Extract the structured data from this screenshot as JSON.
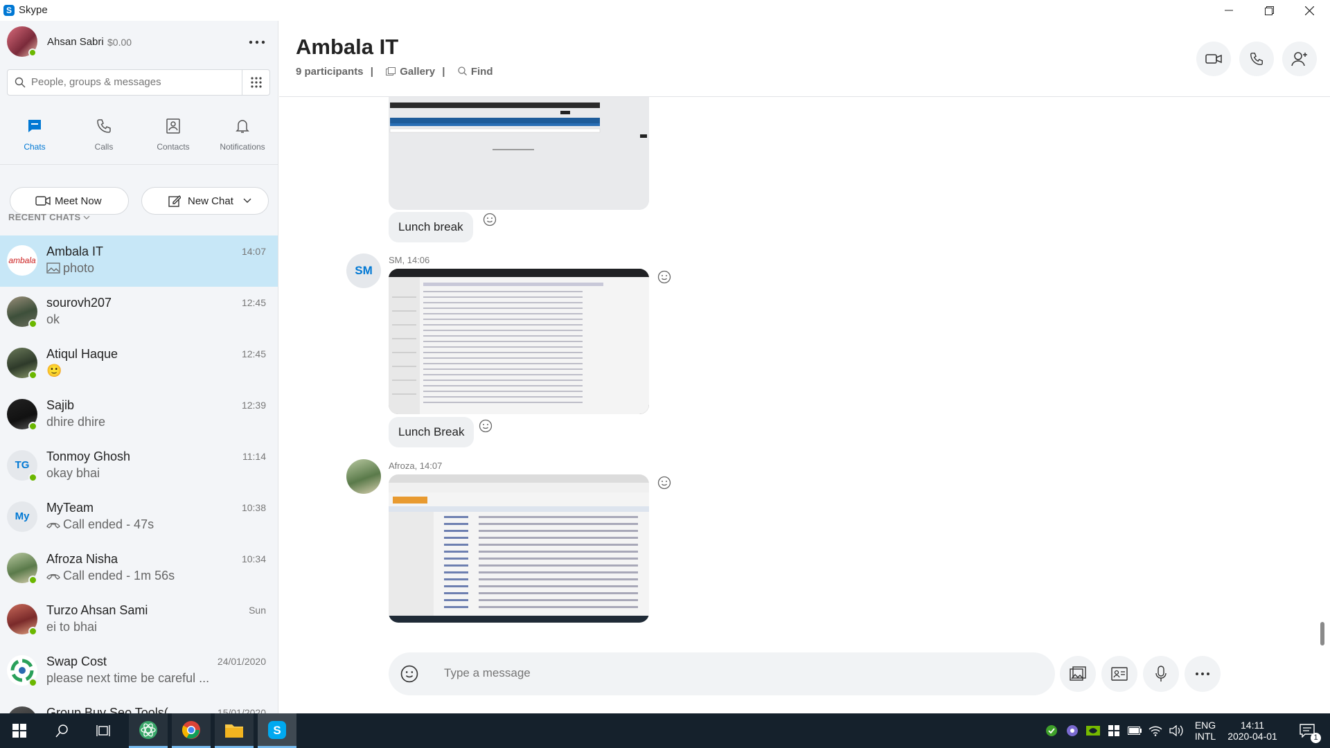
{
  "window": {
    "app_title": "Skype"
  },
  "profile": {
    "name": "Ahsan Sabri",
    "credit": "$0.00"
  },
  "search": {
    "placeholder": "People, groups & messages"
  },
  "nav": [
    {
      "label": "Chats",
      "icon": "chat-icon",
      "active": true
    },
    {
      "label": "Calls",
      "icon": "phone-icon"
    },
    {
      "label": "Contacts",
      "icon": "contacts-icon"
    },
    {
      "label": "Notifications",
      "icon": "bell-icon"
    }
  ],
  "actions": {
    "meet_now": "Meet Now",
    "new_chat": "New Chat"
  },
  "recent_header": "RECENT CHATS",
  "chats": [
    {
      "name": "Ambala IT",
      "preview": "photo",
      "time": "14:07",
      "avatar_text": "ambala",
      "selected": true
    },
    {
      "name": "sourovh207",
      "preview": "ok",
      "time": "12:45"
    },
    {
      "name": "Atiqul Haque",
      "preview": "🙂",
      "time": "12:45"
    },
    {
      "name": "Sajib",
      "preview": "dhire dhire",
      "time": "12:39"
    },
    {
      "name": "Tonmoy Ghosh",
      "preview": "okay bhai",
      "time": "11:14",
      "avatar_text": "TG"
    },
    {
      "name": "MyTeam",
      "preview": "Call ended - 47s",
      "time": "10:38",
      "avatar_text": "My"
    },
    {
      "name": "Afroza Nisha",
      "preview": "Call ended - 1m 56s",
      "time": "10:34"
    },
    {
      "name": "Turzo Ahsan Sami",
      "preview": "ei to bhai",
      "time": "Sun"
    },
    {
      "name": "Swap Cost",
      "preview": "please next time be careful ...",
      "time": "24/01/2020"
    },
    {
      "name": "Group Buy Seo Tools(",
      "preview": "",
      "time": "15/01/2020"
    }
  ],
  "conversation": {
    "title": "Ambala IT",
    "participants": "9 participants",
    "gallery": "Gallery",
    "find": "Find",
    "messages": [
      {
        "caption": "Lunch break"
      },
      {
        "sender": "SM, 14:06",
        "avatar_text": "SM",
        "caption": "Lunch Break"
      },
      {
        "sender": "Afroza, 14:07"
      }
    ],
    "composer_placeholder": "Type a message"
  },
  "taskbar": {
    "lang": "ENG",
    "layout": "INTL",
    "time": "14:11",
    "date": "2020-04-01",
    "notification_count": "1"
  },
  "colors": {
    "accent": "#0078d4",
    "selected_chat": "#c7e7f7",
    "presence": "#6bb700",
    "taskbar": "#15212c"
  }
}
